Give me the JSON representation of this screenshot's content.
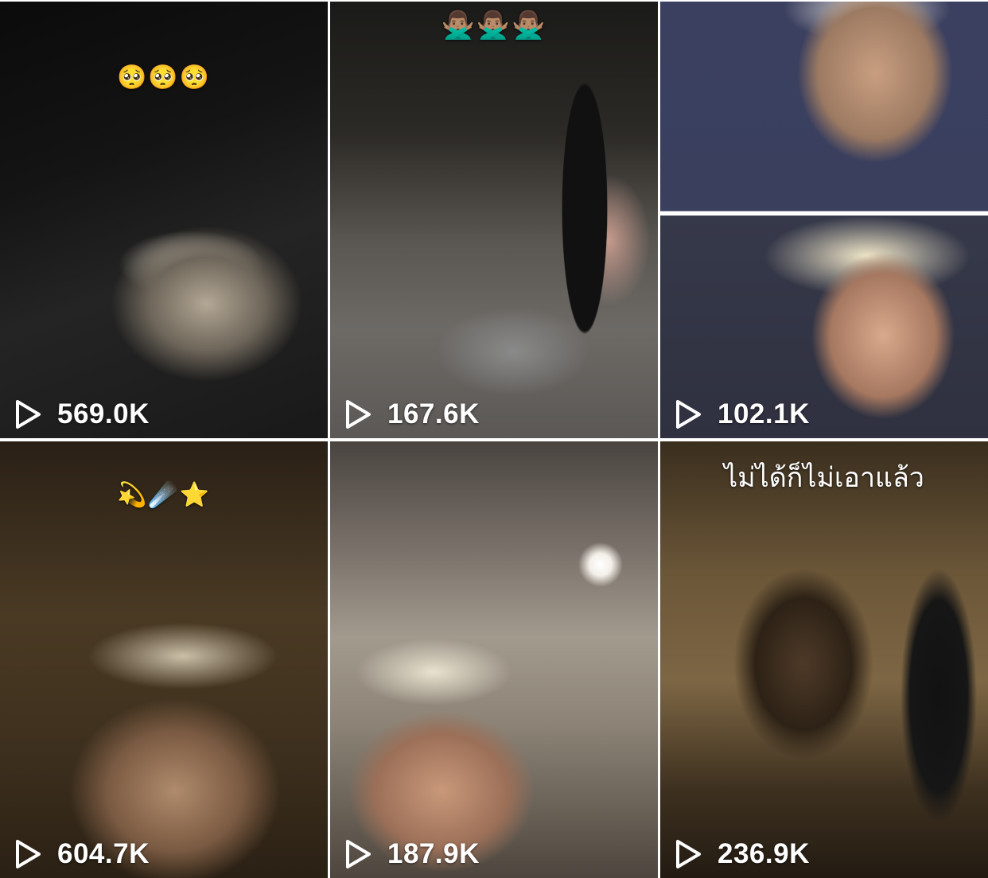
{
  "videos": [
    {
      "caption": "🥺🥺🥺",
      "views": "569.0K",
      "icon": "play-outline-icon"
    },
    {
      "caption": "🙅🏽‍♂️🙅🏽‍♂️🙅🏽‍♂️",
      "views": "167.6K",
      "icon": "play-outline-icon"
    },
    {
      "caption": "",
      "views": "102.1K",
      "icon": "play-outline-icon"
    },
    {
      "caption": "💫☄️⭐",
      "views": "604.7K",
      "icon": "play-outline-icon"
    },
    {
      "caption": "",
      "views": "187.9K",
      "icon": "play-outline-icon"
    },
    {
      "caption": "ไม่ได้ก็ไม่เอาแล้ว",
      "views": "236.9K",
      "icon": "play-outline-icon"
    }
  ]
}
